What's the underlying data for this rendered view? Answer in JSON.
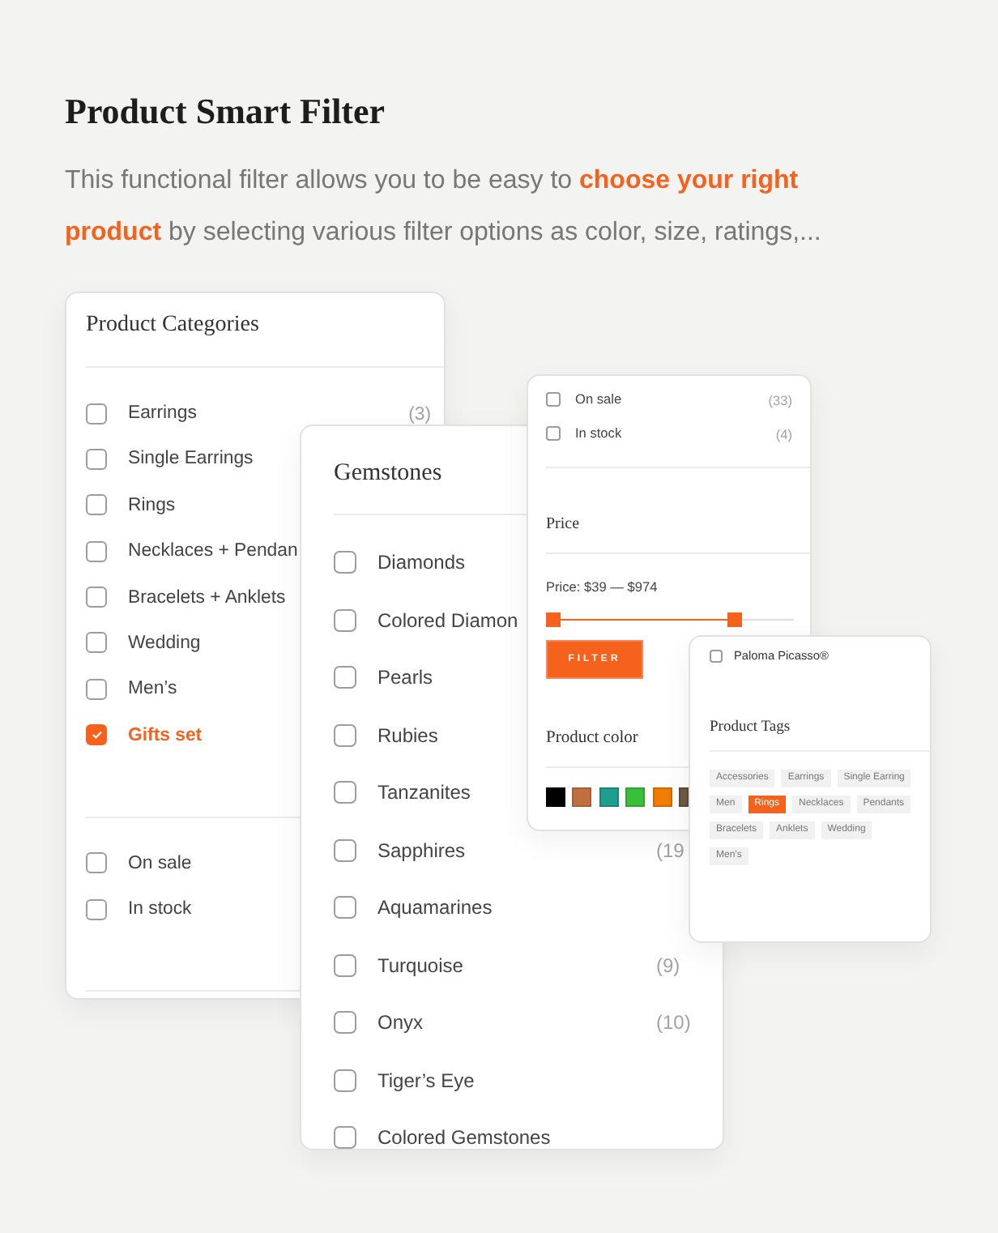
{
  "header": {
    "title": "Product Smart Filter",
    "description": "This functional filter allows you to be easy to **choose your right product** by selecting various filter options as color, size, ratings,..."
  },
  "categories_panel": {
    "title": "Product Categories",
    "categories": [
      {
        "label": "Earrings",
        "count": "(3)",
        "checked": false
      },
      {
        "label": "Single Earrings",
        "checked": false
      },
      {
        "label": "Rings",
        "checked": false
      },
      {
        "label": "Necklaces + Pendan",
        "checked": false
      },
      {
        "label": "Bracelets + Anklets",
        "checked": false
      },
      {
        "label": "Wedding",
        "checked": false
      },
      {
        "label": "Men’s",
        "checked": false
      },
      {
        "label": "Gifts set",
        "checked": true
      }
    ],
    "stock_filters": [
      {
        "label": "On sale",
        "checked": false
      },
      {
        "label": "In stock",
        "checked": false
      }
    ]
  },
  "gemstones_panel": {
    "title": "Gemstones",
    "gemstones": [
      {
        "label": "Diamonds",
        "checked": false
      },
      {
        "label": "Colored Diamon",
        "checked": false
      },
      {
        "label": "Pearls",
        "checked": false
      },
      {
        "label": "Rubies",
        "checked": false
      },
      {
        "label": "Tanzanites",
        "checked": false
      },
      {
        "label": "Sapphires",
        "count": "(19",
        "checked": false
      },
      {
        "label": "Aquamarines",
        "checked": false
      },
      {
        "label": "Turquoise",
        "count": "(9)",
        "checked": false
      },
      {
        "label": "Onyx",
        "count": "(10)",
        "checked": false
      },
      {
        "label": "Tiger’s Eye",
        "checked": false
      },
      {
        "label": "Colored Gemstones",
        "checked": false
      }
    ]
  },
  "price_panel": {
    "stock_filters": [
      {
        "label": "On sale",
        "count": "(33)",
        "checked": false
      },
      {
        "label": "In stock",
        "count": "(4)",
        "checked": false
      }
    ],
    "price_title": "Price",
    "price_range": "Price: $39 — $974",
    "slider": {
      "handles": [
        {
          "level": 0
        },
        {
          "level": 0.78
        }
      ]
    },
    "filter_button": "FILTER",
    "color_title": "Product color",
    "swatches": [
      {
        "color": "#000000"
      },
      {
        "color": "#c0703f"
      },
      {
        "color": "#1f9e8f"
      },
      {
        "color": "#3bbf3b"
      },
      {
        "color": "#f07c00"
      },
      {
        "color": "#6e5a45"
      }
    ]
  },
  "tags_panel": {
    "options": [
      {
        "label": "Paloma Picasso®",
        "checked": false
      }
    ],
    "title": "Product Tags",
    "tags": [
      {
        "label": "Accessories",
        "selected": false
      },
      {
        "label": "Earrings",
        "selected": false
      },
      {
        "label": "Single Earring",
        "selected": false
      },
      {
        "label": "Men",
        "selected": false
      },
      {
        "label": "Rings",
        "selected": true
      },
      {
        "label": "Necklaces",
        "selected": false
      },
      {
        "label": "Pendants",
        "selected": false
      },
      {
        "label": "Bracelets",
        "selected": false
      },
      {
        "label": "Anklets",
        "selected": false
      },
      {
        "label": "Wedding",
        "selected": false
      },
      {
        "label": "Men's",
        "selected": false
      }
    ]
  }
}
